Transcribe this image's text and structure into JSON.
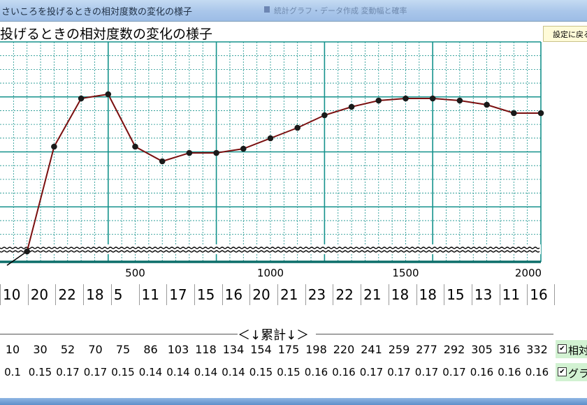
{
  "window": {
    "title": "さいころを投げるときの相対度数の変化の様子",
    "background_title": "統計グラフ・データ作成 変動幅と確率"
  },
  "heading": "投げるときの相対度数の変化の様子",
  "settings_button": "設定に戻る",
  "chart_data": {
    "type": "line",
    "x_tick_labels": [
      "500",
      "1000",
      "1500",
      "2000"
    ],
    "x": [
      100,
      200,
      300,
      400,
      500,
      600,
      700,
      800,
      900,
      1000,
      1100,
      1200,
      1300,
      1400,
      1500,
      1600,
      1700,
      1800,
      1900,
      2000
    ],
    "y": [
      0.1,
      0.15,
      0.173,
      0.175,
      0.15,
      0.143,
      0.147,
      0.147,
      0.149,
      0.154,
      0.159,
      0.165,
      0.169,
      0.172,
      0.173,
      0.173,
      0.172,
      0.17,
      0.166,
      0.166
    ],
    "xlim": [
      0,
      2000
    ],
    "ylim": [
      0.095,
      0.2
    ],
    "y_axis_break": true,
    "grid": true,
    "line_color": "#7a0f0f",
    "marker_color": "#1a1a1a",
    "grid_color": "#15928c"
  },
  "counts": [
    "10",
    "20",
    "22",
    "18",
    "5",
    "11",
    "17",
    "15",
    "16",
    "20",
    "21",
    "23",
    "22",
    "21",
    "18",
    "18",
    "15",
    "13",
    "11",
    "16"
  ],
  "cumulative_label": "＜↓累計↓＞",
  "cumulative": [
    "10",
    "30",
    "52",
    "70",
    "75",
    "86",
    "103",
    "118",
    "134",
    "154",
    "175",
    "198",
    "220",
    "241",
    "259",
    "277",
    "292",
    "305",
    "316",
    "332"
  ],
  "frequency": [
    "0.1",
    "0.15",
    "0.17",
    "0.17",
    "0.15",
    "0.14",
    "0.14",
    "0.14",
    "0.14",
    "0.15",
    "0.15",
    "0.16",
    "0.16",
    "0.17",
    "0.17",
    "0.17",
    "0.17",
    "0.16",
    "0.16",
    "0.16"
  ],
  "options": [
    {
      "label": "相対",
      "checked": true
    },
    {
      "label": "グラ",
      "checked": true
    }
  ]
}
